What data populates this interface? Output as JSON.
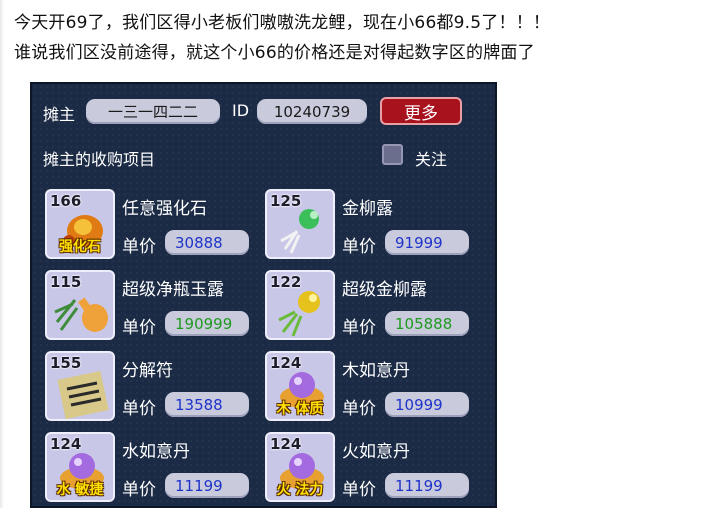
{
  "post": {
    "line1": "今天开69了，我们区得小老板们嗷嗷洗龙鲤，现在小66都9.5了！！！",
    "line2": "谁说我们区没前途得，就这个小66的价格还是对得起数字区的牌面了"
  },
  "stall": {
    "owner_label": "摊主",
    "owner_name": "一三一四二二",
    "id_label": "ID",
    "id_value": "10240739",
    "more_button": "更多",
    "section_title": "摊主的收购项目",
    "follow_label": "关注",
    "price_label": "单价",
    "items": [
      {
        "name": "任意强化石",
        "level": "166",
        "price": "30888",
        "tag": "强化石",
        "price_color": "#1f33c9"
      },
      {
        "name": "金柳露",
        "level": "125",
        "price": "91999",
        "tag": "",
        "price_color": "#1f33c9"
      },
      {
        "name": "超级净瓶玉露",
        "level": "115",
        "price": "190999",
        "tag": "",
        "price_color": "#1f9a1f"
      },
      {
        "name": "超级金柳露",
        "level": "122",
        "price": "105888",
        "tag": "",
        "price_color": "#1f9a1f"
      },
      {
        "name": "分解符",
        "level": "155",
        "price": "13588",
        "tag": "",
        "price_color": "#1f33c9"
      },
      {
        "name": "木如意丹",
        "level": "124",
        "price": "10999",
        "tag": "木 体质",
        "price_color": "#1f33c9"
      },
      {
        "name": "水如意丹",
        "level": "124",
        "price": "11199",
        "tag": "水 敏捷",
        "price_color": "#1f33c9"
      },
      {
        "name": "火如意丹",
        "level": "124",
        "price": "11199",
        "tag": "火 法力",
        "price_color": "#1f33c9"
      }
    ]
  }
}
